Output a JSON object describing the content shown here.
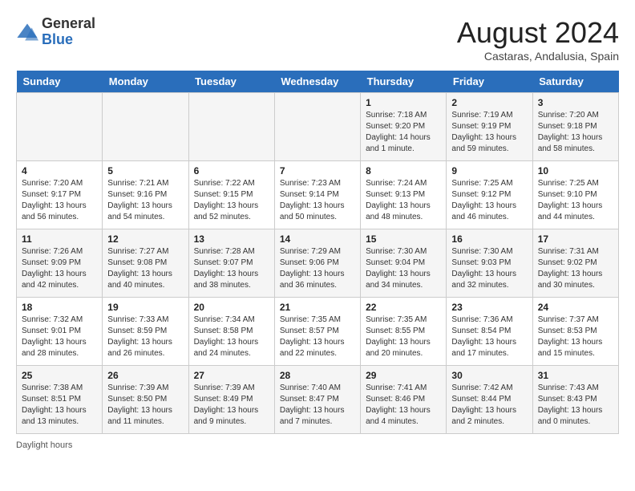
{
  "header": {
    "logo_general": "General",
    "logo_blue": "Blue",
    "month_year": "August 2024",
    "location": "Castaras, Andalusia, Spain"
  },
  "days_of_week": [
    "Sunday",
    "Monday",
    "Tuesday",
    "Wednesday",
    "Thursday",
    "Friday",
    "Saturday"
  ],
  "weeks": [
    [
      {
        "day": "",
        "info": ""
      },
      {
        "day": "",
        "info": ""
      },
      {
        "day": "",
        "info": ""
      },
      {
        "day": "",
        "info": ""
      },
      {
        "day": "1",
        "info": "Sunrise: 7:18 AM\nSunset: 9:20 PM\nDaylight: 14 hours and 1 minute."
      },
      {
        "day": "2",
        "info": "Sunrise: 7:19 AM\nSunset: 9:19 PM\nDaylight: 13 hours and 59 minutes."
      },
      {
        "day": "3",
        "info": "Sunrise: 7:20 AM\nSunset: 9:18 PM\nDaylight: 13 hours and 58 minutes."
      }
    ],
    [
      {
        "day": "4",
        "info": "Sunrise: 7:20 AM\nSunset: 9:17 PM\nDaylight: 13 hours and 56 minutes."
      },
      {
        "day": "5",
        "info": "Sunrise: 7:21 AM\nSunset: 9:16 PM\nDaylight: 13 hours and 54 minutes."
      },
      {
        "day": "6",
        "info": "Sunrise: 7:22 AM\nSunset: 9:15 PM\nDaylight: 13 hours and 52 minutes."
      },
      {
        "day": "7",
        "info": "Sunrise: 7:23 AM\nSunset: 9:14 PM\nDaylight: 13 hours and 50 minutes."
      },
      {
        "day": "8",
        "info": "Sunrise: 7:24 AM\nSunset: 9:13 PM\nDaylight: 13 hours and 48 minutes."
      },
      {
        "day": "9",
        "info": "Sunrise: 7:25 AM\nSunset: 9:12 PM\nDaylight: 13 hours and 46 minutes."
      },
      {
        "day": "10",
        "info": "Sunrise: 7:25 AM\nSunset: 9:10 PM\nDaylight: 13 hours and 44 minutes."
      }
    ],
    [
      {
        "day": "11",
        "info": "Sunrise: 7:26 AM\nSunset: 9:09 PM\nDaylight: 13 hours and 42 minutes."
      },
      {
        "day": "12",
        "info": "Sunrise: 7:27 AM\nSunset: 9:08 PM\nDaylight: 13 hours and 40 minutes."
      },
      {
        "day": "13",
        "info": "Sunrise: 7:28 AM\nSunset: 9:07 PM\nDaylight: 13 hours and 38 minutes."
      },
      {
        "day": "14",
        "info": "Sunrise: 7:29 AM\nSunset: 9:06 PM\nDaylight: 13 hours and 36 minutes."
      },
      {
        "day": "15",
        "info": "Sunrise: 7:30 AM\nSunset: 9:04 PM\nDaylight: 13 hours and 34 minutes."
      },
      {
        "day": "16",
        "info": "Sunrise: 7:30 AM\nSunset: 9:03 PM\nDaylight: 13 hours and 32 minutes."
      },
      {
        "day": "17",
        "info": "Sunrise: 7:31 AM\nSunset: 9:02 PM\nDaylight: 13 hours and 30 minutes."
      }
    ],
    [
      {
        "day": "18",
        "info": "Sunrise: 7:32 AM\nSunset: 9:01 PM\nDaylight: 13 hours and 28 minutes."
      },
      {
        "day": "19",
        "info": "Sunrise: 7:33 AM\nSunset: 8:59 PM\nDaylight: 13 hours and 26 minutes."
      },
      {
        "day": "20",
        "info": "Sunrise: 7:34 AM\nSunset: 8:58 PM\nDaylight: 13 hours and 24 minutes."
      },
      {
        "day": "21",
        "info": "Sunrise: 7:35 AM\nSunset: 8:57 PM\nDaylight: 13 hours and 22 minutes."
      },
      {
        "day": "22",
        "info": "Sunrise: 7:35 AM\nSunset: 8:55 PM\nDaylight: 13 hours and 20 minutes."
      },
      {
        "day": "23",
        "info": "Sunrise: 7:36 AM\nSunset: 8:54 PM\nDaylight: 13 hours and 17 minutes."
      },
      {
        "day": "24",
        "info": "Sunrise: 7:37 AM\nSunset: 8:53 PM\nDaylight: 13 hours and 15 minutes."
      }
    ],
    [
      {
        "day": "25",
        "info": "Sunrise: 7:38 AM\nSunset: 8:51 PM\nDaylight: 13 hours and 13 minutes."
      },
      {
        "day": "26",
        "info": "Sunrise: 7:39 AM\nSunset: 8:50 PM\nDaylight: 13 hours and 11 minutes."
      },
      {
        "day": "27",
        "info": "Sunrise: 7:39 AM\nSunset: 8:49 PM\nDaylight: 13 hours and 9 minutes."
      },
      {
        "day": "28",
        "info": "Sunrise: 7:40 AM\nSunset: 8:47 PM\nDaylight: 13 hours and 7 minutes."
      },
      {
        "day": "29",
        "info": "Sunrise: 7:41 AM\nSunset: 8:46 PM\nDaylight: 13 hours and 4 minutes."
      },
      {
        "day": "30",
        "info": "Sunrise: 7:42 AM\nSunset: 8:44 PM\nDaylight: 13 hours and 2 minutes."
      },
      {
        "day": "31",
        "info": "Sunrise: 7:43 AM\nSunset: 8:43 PM\nDaylight: 13 hours and 0 minutes."
      }
    ]
  ],
  "footer": {
    "note": "Daylight hours"
  }
}
